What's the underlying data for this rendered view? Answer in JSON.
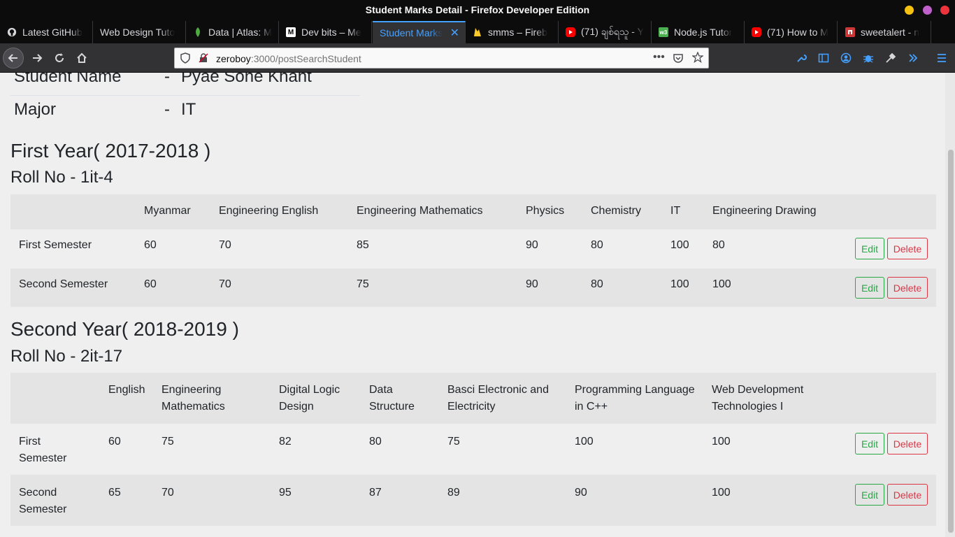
{
  "window": {
    "title": "Student Marks Detail - Firefox Developer Edition"
  },
  "tabs": [
    {
      "label": "Latest GitHub",
      "icon": "github-icon"
    },
    {
      "label": "Web Design Tuto",
      "icon": "generic-page-icon"
    },
    {
      "label": "Data | Atlas: M",
      "icon": "mongodb-leaf-icon"
    },
    {
      "label": "Dev bits – Me",
      "icon": "medium-icon"
    },
    {
      "label": "Student Marks",
      "icon": "none"
    },
    {
      "label": "smms – Fireb",
      "icon": "firebase-icon"
    },
    {
      "label": "(71) ချစ်ရသူ - Y",
      "icon": "youtube-icon"
    },
    {
      "label": "Node.js Tutor",
      "icon": "w3schools-icon"
    },
    {
      "label": "(71) How to M",
      "icon": "youtube-icon"
    },
    {
      "label": "sweetalert - n",
      "icon": "npm-icon"
    }
  ],
  "navbar": {
    "url_host": "zeroboy",
    "url_rest": ":3000/postSearchStudent"
  },
  "student": {
    "name_label": "Student Name",
    "name_dash": "-",
    "name_value": "Pyae Sone Khant",
    "major_label": "Major",
    "major_dash": "-",
    "major_value": "IT"
  },
  "years": [
    {
      "title": "First Year( 2017-2018 )",
      "roll": "Roll No - 1it-4",
      "headers": [
        "",
        "Myanmar",
        "Engineering English",
        "Engineering Mathematics",
        "Physics",
        "Chemistry",
        "IT",
        "Engineering Drawing"
      ],
      "rows": [
        {
          "semester": "First Semester",
          "marks": [
            "60",
            "70",
            "85",
            "90",
            "80",
            "100",
            "80"
          ]
        },
        {
          "semester": "Second Semester",
          "marks": [
            "60",
            "70",
            "75",
            "90",
            "80",
            "100",
            "100"
          ]
        }
      ],
      "edit_label": "Edit",
      "delete_label": "Delete"
    },
    {
      "title": "Second Year( 2018-2019 )",
      "roll": "Roll No - 2it-17",
      "headers": [
        "",
        "English",
        "Engineering Mathematics",
        "Digital Logic Design",
        "Data Structure",
        "Basci Electronic and Electricity",
        "Programming Language in C++",
        "Web Development Technologies I"
      ],
      "rows": [
        {
          "semester": "First Semester",
          "marks": [
            "60",
            "75",
            "82",
            "80",
            "75",
            "100",
            "100"
          ]
        },
        {
          "semester": "Second Semester",
          "marks": [
            "65",
            "70",
            "95",
            "87",
            "89",
            "90",
            "100"
          ]
        }
      ],
      "edit_label": "Edit",
      "delete_label": "Delete"
    }
  ],
  "colors": {
    "accent": "#45a1ff",
    "edit": "#28a745",
    "delete": "#dc3545"
  }
}
